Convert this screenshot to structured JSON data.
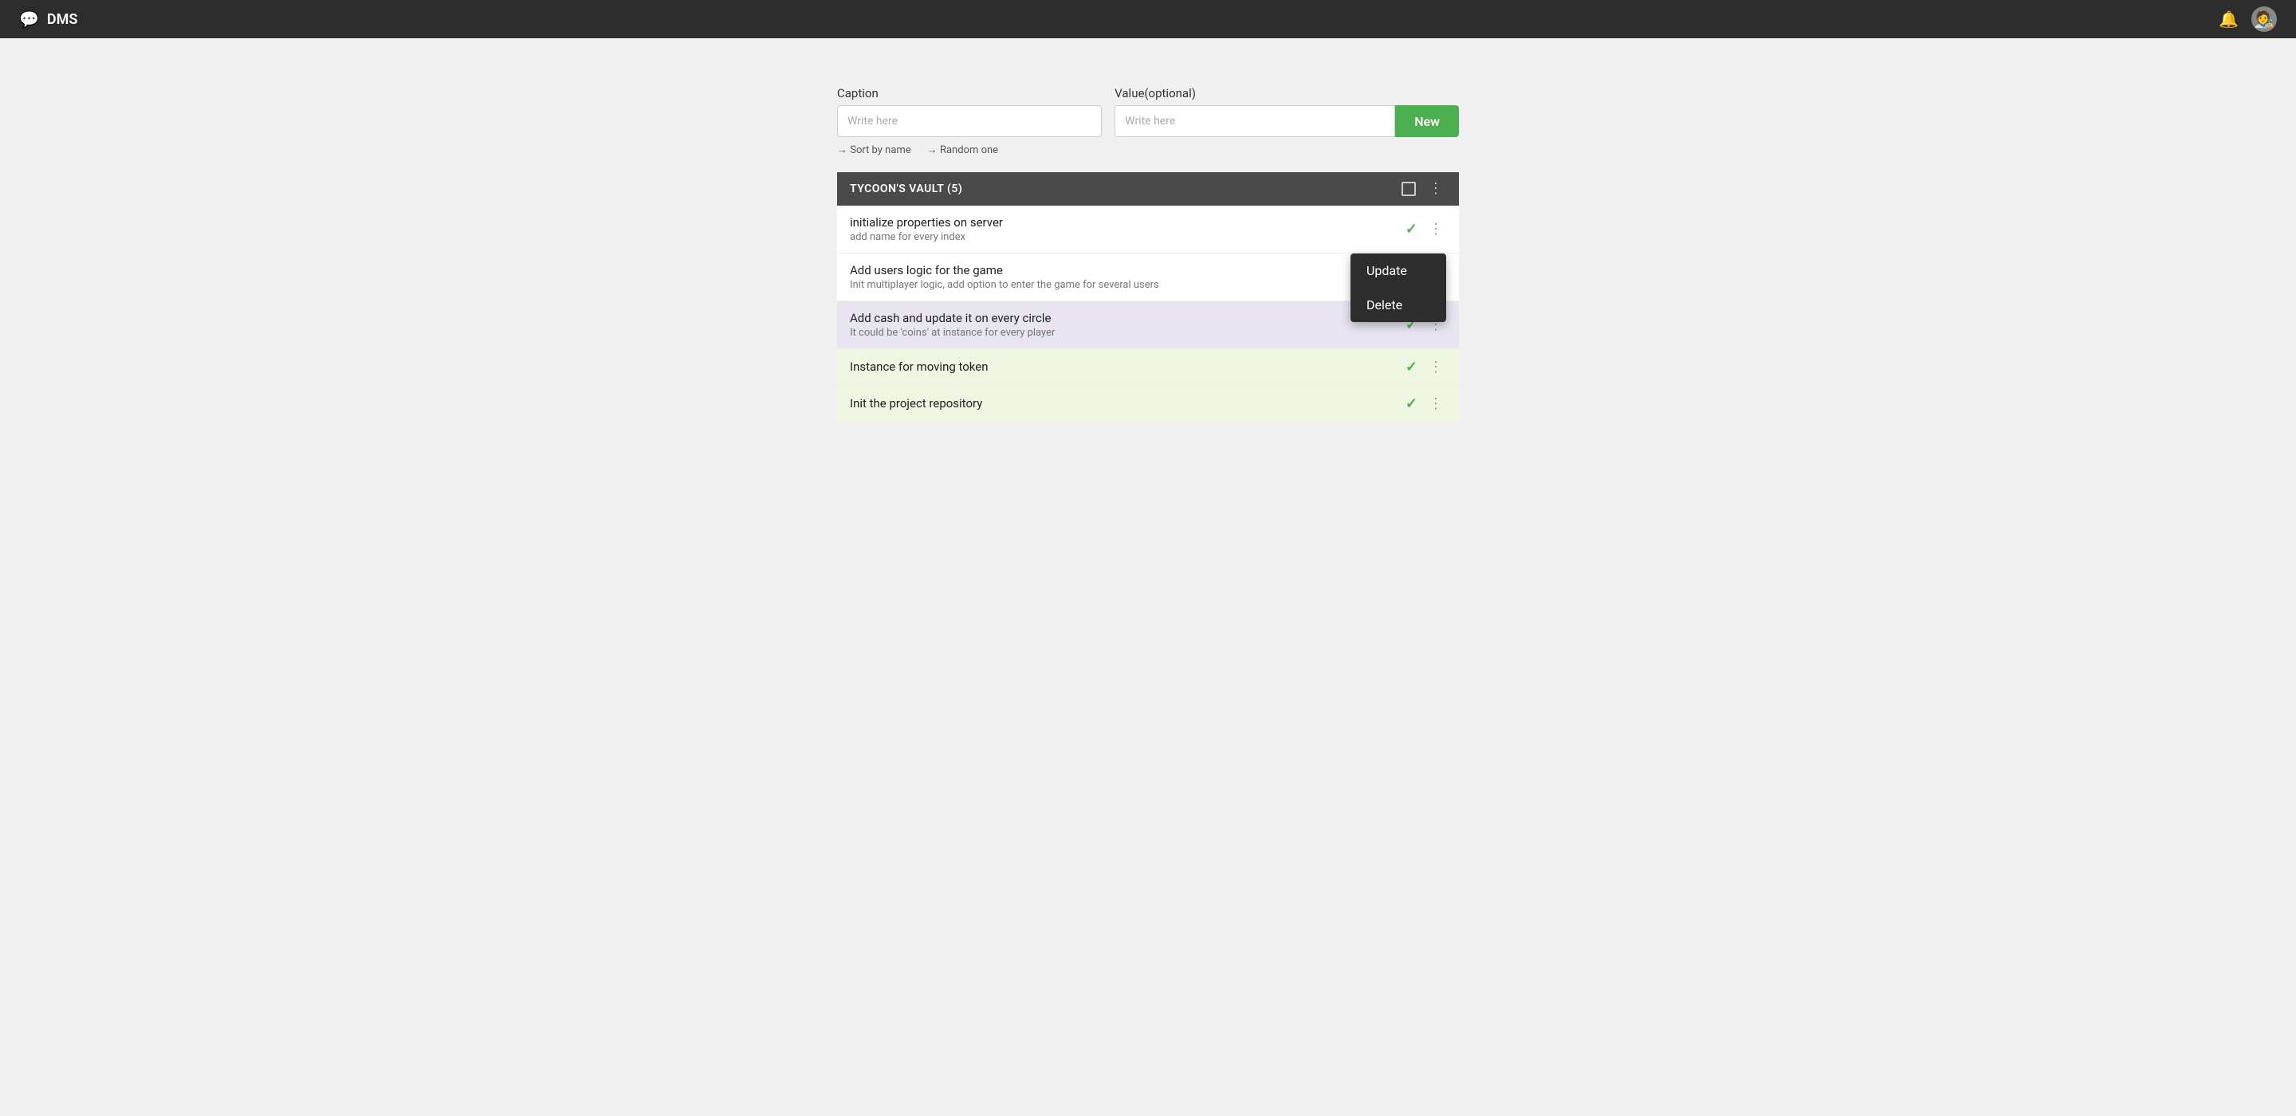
{
  "app": {
    "title": "DMS",
    "icon": "💬"
  },
  "header": {
    "bell_label": "🔔",
    "avatar_emoji": "🧑‍🎨"
  },
  "form": {
    "caption_label": "Caption",
    "caption_placeholder": "Write here",
    "value_label": "Value(optional)",
    "value_placeholder": "Write here",
    "new_button_label": "New",
    "sort_by_name": "→ Sort by name",
    "random_one": "→ Random one"
  },
  "list": {
    "title": "TYCOON'S VAULT (5)",
    "items": [
      {
        "id": 1,
        "title": "initialize properties on server",
        "subtitle": "add name for every index",
        "checked": true,
        "bg": "white",
        "dropdown_open": false
      },
      {
        "id": 2,
        "title": "Add users logic for the game",
        "subtitle": "Init multiplayer logic, add option to enter the game for several users",
        "checked": false,
        "bg": "white",
        "dropdown_open": true
      },
      {
        "id": 3,
        "title": "Add cash and update it on every circle",
        "subtitle": "It could be 'coins' at instance for every player",
        "checked": true,
        "bg": "purple",
        "dropdown_open": false
      },
      {
        "id": 4,
        "title": "Instance for moving token",
        "subtitle": "",
        "checked": true,
        "bg": "green",
        "dropdown_open": false
      },
      {
        "id": 5,
        "title": "Init the project repository",
        "subtitle": "",
        "checked": true,
        "bg": "green",
        "dropdown_open": false
      }
    ],
    "dropdown_menu": {
      "update_label": "Update",
      "delete_label": "Delete"
    }
  }
}
